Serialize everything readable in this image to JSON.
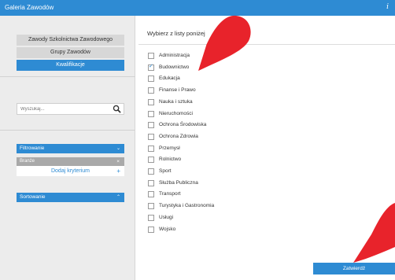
{
  "window": {
    "title": "Galeria Zawodów",
    "info_icon": "i"
  },
  "sidebar": {
    "categories": [
      {
        "label": "Zawody Szkolnictwa Zawodowego",
        "active": false
      },
      {
        "label": "Grupy Zawodów",
        "active": false
      },
      {
        "label": "Kwalifikacje",
        "active": true
      }
    ],
    "search": {
      "placeholder": "Wyszukaj..."
    },
    "filter": {
      "header": "Filtrowanie",
      "selected": "Branże",
      "remove_glyph": "×",
      "add_label": "Dodaj kryterium",
      "add_glyph": "+"
    },
    "sort": {
      "header": "Sortowanie"
    }
  },
  "main": {
    "heading": "Wybierz z listy poniżej",
    "options": [
      {
        "label": "Administracja",
        "checked": false
      },
      {
        "label": "Budownictwo",
        "checked": true
      },
      {
        "label": "Edukacja",
        "checked": false
      },
      {
        "label": "Finanse i Prawo",
        "checked": false
      },
      {
        "label": "Nauka i sztuka",
        "checked": false
      },
      {
        "label": "Nieruchomości",
        "checked": false
      },
      {
        "label": "Ochrona Środowiska",
        "checked": false
      },
      {
        "label": "Ochrona Zdrowia",
        "checked": false
      },
      {
        "label": "Przemysł",
        "checked": false
      },
      {
        "label": "Rolnictwo",
        "checked": false
      },
      {
        "label": "Sport",
        "checked": false
      },
      {
        "label": "Służba Publiczna",
        "checked": false
      },
      {
        "label": "Transport",
        "checked": false
      },
      {
        "label": "Turystyka i Gastronomia",
        "checked": false
      },
      {
        "label": "Usługi",
        "checked": false
      },
      {
        "label": "Wojsko",
        "checked": false
      }
    ],
    "submit_label": "Zatwierdź"
  },
  "colors": {
    "accent": "#2e8bd3",
    "pointer": "#e8232b",
    "sidebar_bg": "#ececec",
    "button_grey": "#d7d7d7"
  }
}
